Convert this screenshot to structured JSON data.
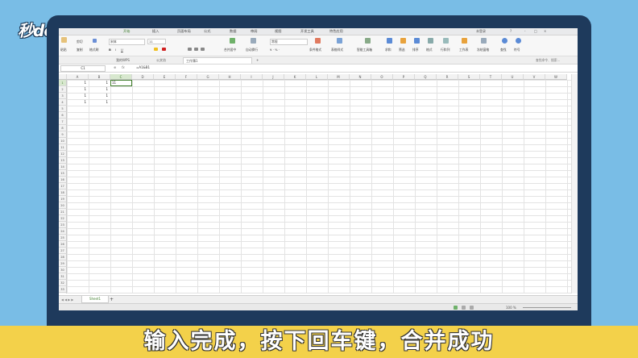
{
  "watermark": "秒dong视频",
  "subtitle": "输入完成，按下回车键，合并成功",
  "menu": {
    "items": [
      "开始",
      "插入",
      "页面布局",
      "公式",
      "数据",
      "审阅",
      "视图",
      "开发工具",
      "特色应用"
    ],
    "right": [
      "未登录",
      "?",
      "-",
      "□",
      "×"
    ]
  },
  "ribbon": {
    "cut": "剪切",
    "paste": "粘贴",
    "copy": "复制",
    "format_painter": "格式刷",
    "font_name": "宋体",
    "font_size": "11",
    "merge_center": "合并居中",
    "wrap": "自动换行",
    "number_format": "常规",
    "cond_format": "条件格式",
    "table_style": "表格样式",
    "doc_helper": "智能工具箱",
    "sum": "求和",
    "filter": "筛选",
    "sort": "排序",
    "format": "格式",
    "row_col": "行和列",
    "worksheet": "工作表",
    "freeze": "冻结窗格",
    "find": "查找",
    "symbol": "符号",
    "search_placeholder": "查找命令、搜索..."
  },
  "docbar": {
    "tabs": [
      "我的WPS",
      "公文坊",
      "工作簿1"
    ],
    "active_index": 2
  },
  "formula_bar": {
    "name_box": "C1",
    "fx_label": "fx",
    "formula": "=A1&B1"
  },
  "grid": {
    "columns": [
      "A",
      "B",
      "C",
      "D",
      "E",
      "F",
      "G",
      "H",
      "I",
      "J",
      "K",
      "L",
      "M",
      "N",
      "O",
      "P",
      "Q",
      "R",
      "S",
      "T",
      "U",
      "V",
      "W"
    ],
    "selected_column": "C",
    "row_count": 34,
    "selected_row": 1,
    "values": [
      {
        "row": 1,
        "col": "A",
        "value": "1"
      },
      {
        "row": 1,
        "col": "B",
        "value": "1"
      },
      {
        "row": 1,
        "col": "C",
        "value": "11"
      },
      {
        "row": 2,
        "col": "A",
        "value": "1"
      },
      {
        "row": 2,
        "col": "B",
        "value": "1"
      },
      {
        "row": 3,
        "col": "A",
        "value": "1"
      },
      {
        "row": 3,
        "col": "B",
        "value": "1"
      },
      {
        "row": 4,
        "col": "A",
        "value": "1"
      },
      {
        "row": 4,
        "col": "B",
        "value": "1"
      }
    ]
  },
  "sheets": [
    "Sheet1"
  ],
  "status": {
    "zoom": "100 %"
  },
  "colors": {
    "accent": "#3f7d2b",
    "background": "#79bde6",
    "subtitle_bar": "#f3d14a",
    "laptop_frame": "#1e3a5c"
  }
}
